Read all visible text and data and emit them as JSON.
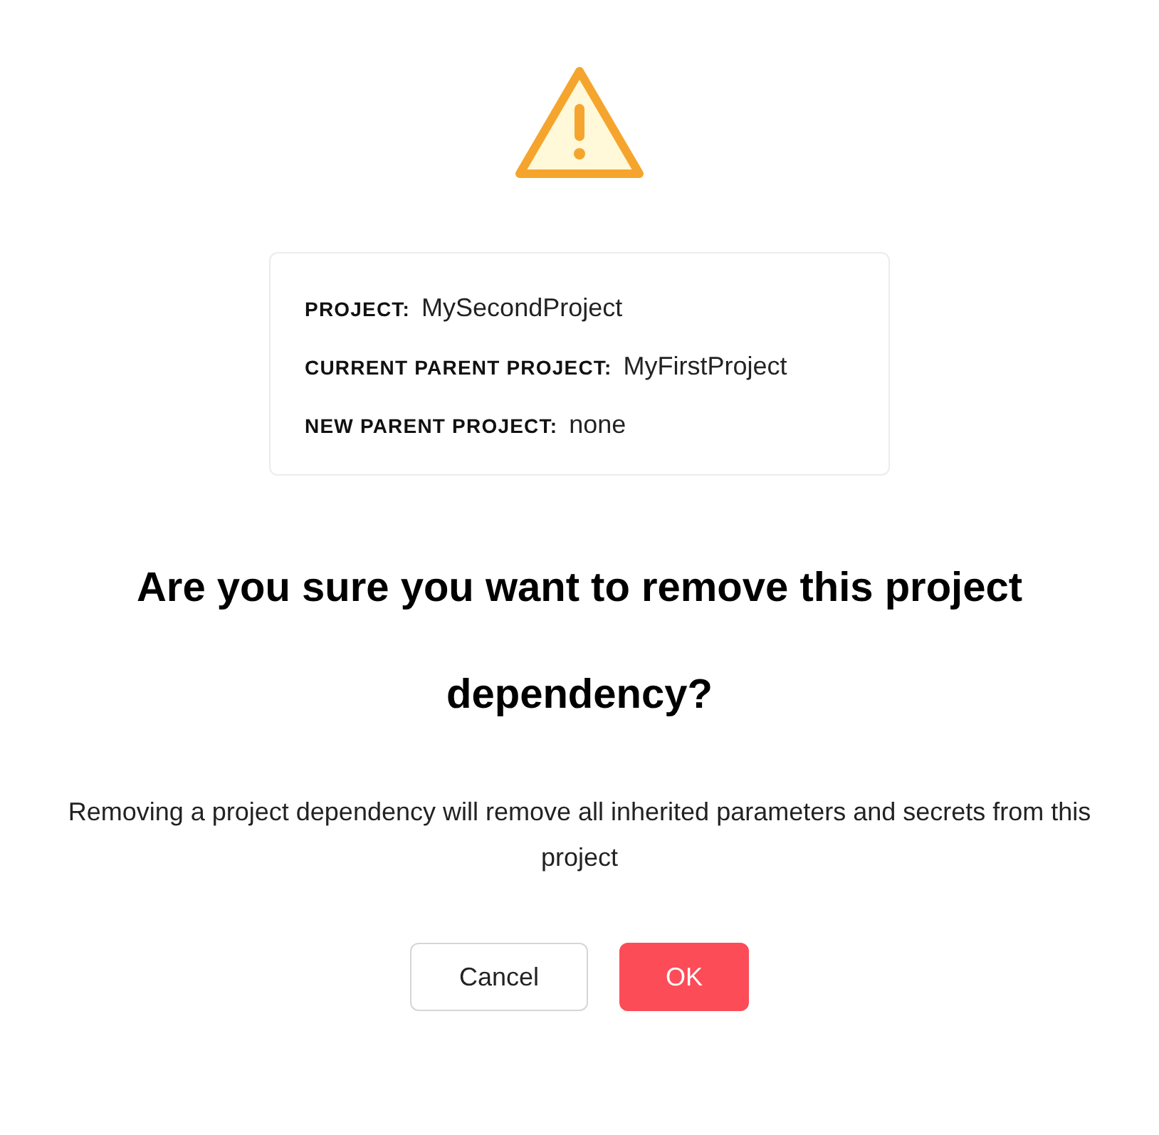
{
  "details": [
    {
      "label": "PROJECT:",
      "value": "MySecondProject"
    },
    {
      "label": "CURRENT PARENT PROJECT:",
      "value": "MyFirstProject"
    },
    {
      "label": "NEW PARENT PROJECT:",
      "value": "none"
    }
  ],
  "title": "Are you sure you want to remove this project dependency?",
  "message": "Removing a project dependency will remove all inherited parameters and secrets from this project",
  "buttons": [
    {
      "label": "Cancel",
      "kind": "secondary"
    },
    {
      "label": "OK",
      "kind": "primary"
    }
  ]
}
